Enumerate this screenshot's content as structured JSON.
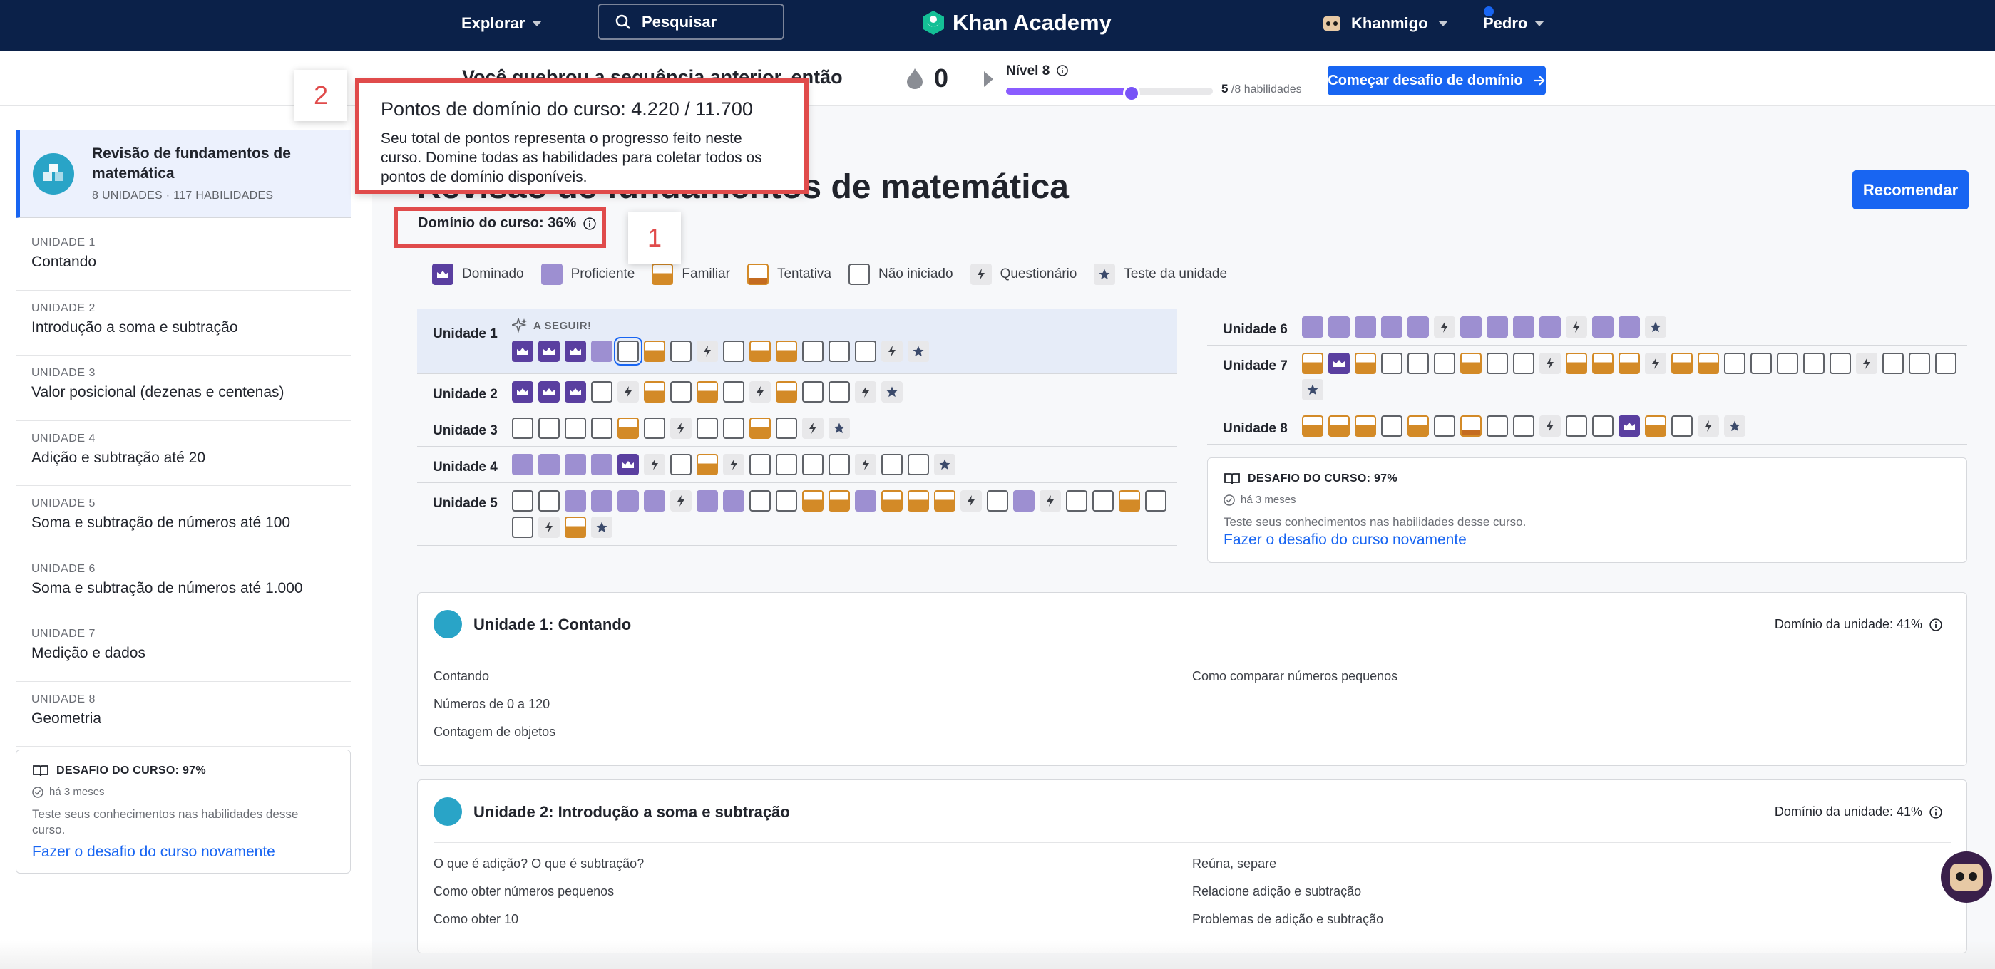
{
  "topbar": {
    "explore": "Explorar",
    "search_placeholder": "Pesquisar",
    "brand": "Khan Academy",
    "khanmigo": "Khanmigo",
    "user": "Pedro"
  },
  "subheader": {
    "streak_message": "Você quebrou a sequência anterior, então",
    "energy_points": "0",
    "level": "Nível 8",
    "level_progress": 0.62,
    "skills_done": "5",
    "skills_total": "/8 habilidades",
    "mastery_button": "Começar desafio de domínio"
  },
  "sidebar": {
    "course_title": "Revisão de fundamentos de matemática",
    "course_meta": "8 UNIDADES · 117 HABILIDADES",
    "units": [
      {
        "label": "UNIDADE 1",
        "name": "Contando"
      },
      {
        "label": "UNIDADE 2",
        "name": "Introdução a soma e subtração"
      },
      {
        "label": "UNIDADE 3",
        "name": "Valor posicional (dezenas e centenas)"
      },
      {
        "label": "UNIDADE 4",
        "name": "Adição e subtração até 20"
      },
      {
        "label": "UNIDADE 5",
        "name": "Soma e subtração de números até 100"
      },
      {
        "label": "UNIDADE 6",
        "name": "Soma e subtração de números até 1.000"
      },
      {
        "label": "UNIDADE 7",
        "name": "Medição e dados"
      },
      {
        "label": "UNIDADE 8",
        "name": "Geometria"
      }
    ],
    "challenge": {
      "title": "DESAFIO DO CURSO: 97%",
      "time": "há 3 meses",
      "desc": "Teste seus conhecimentos nas habilidades desse curso.",
      "link": "Fazer o desafio do curso novamente"
    }
  },
  "main": {
    "course_heading": "Revisão de fundamentos de matemática",
    "recommend": "Recomendar",
    "course_mastery": "Domínio do curso: 36%",
    "legend": {
      "mastered": "Dominado",
      "proficient": "Proficiente",
      "familiar": "Familiar",
      "attempted": "Tentativa",
      "not_started": "Não iniciado",
      "quiz": "Questionário",
      "unit_test": "Teste da unidade"
    },
    "next_up": "A SEGUIR!",
    "unit_rows": [
      {
        "label": "Unidade 1",
        "skills": [
          "M",
          "M",
          "M",
          "P",
          "N*",
          "F",
          "N",
          "Q",
          "N",
          "F",
          "F",
          "N",
          "N",
          "N",
          "Q",
          "T"
        ]
      },
      {
        "label": "Unidade 2",
        "skills": [
          "M",
          "M",
          "M",
          "N",
          "Q",
          "F",
          "N",
          "F",
          "N",
          "Q",
          "F",
          "N",
          "N",
          "Q",
          "T"
        ]
      },
      {
        "label": "Unidade 3",
        "skills": [
          "N",
          "N",
          "N",
          "N",
          "F",
          "N",
          "Q",
          "N",
          "N",
          "F",
          "N",
          "Q",
          "T"
        ]
      },
      {
        "label": "Unidade 4",
        "skills": [
          "P",
          "P",
          "P",
          "P",
          "M",
          "Q",
          "N",
          "F",
          "Q",
          "N",
          "N",
          "N",
          "N",
          "Q",
          "N",
          "N",
          "T"
        ]
      },
      {
        "label": "Unidade 5",
        "skills": [
          "N",
          "N",
          "P",
          "P",
          "P",
          "P",
          "Q",
          "P",
          "P",
          "N",
          "N",
          "F",
          "F",
          "P",
          "F",
          "F",
          "F",
          "Q",
          "N",
          "P",
          "Q",
          "N",
          "N",
          "F",
          "N",
          "N",
          "Q",
          "F",
          "T"
        ]
      },
      {
        "label": "Unidade 6",
        "skills": [
          "P",
          "P",
          "P",
          "P",
          "P",
          "Q",
          "P",
          "P",
          "P",
          "P",
          "Q",
          "P",
          "P",
          "T"
        ]
      },
      {
        "label": "Unidade 7",
        "skills": [
          "F",
          "M",
          "F",
          "N",
          "N",
          "N",
          "F",
          "N",
          "N",
          "Q",
          "F",
          "F",
          "F",
          "Q",
          "F",
          "F",
          "N",
          "N",
          "N",
          "N",
          "N",
          "Q",
          "N",
          "N",
          "N",
          "T"
        ]
      },
      {
        "label": "Unidade 8",
        "skills": [
          "F",
          "F",
          "F",
          "N",
          "F",
          "N",
          "A",
          "N",
          "N",
          "Q",
          "N",
          "N",
          "M",
          "F",
          "N",
          "Q",
          "T"
        ]
      }
    ],
    "right_challenge": {
      "title": "DESAFIO DO CURSO: 97%",
      "time": "há 3 meses",
      "desc": "Teste seus conhecimentos nas habilidades desse curso.",
      "link": "Fazer o desafio do curso novamente"
    },
    "unit_cards": [
      {
        "title": "Unidade 1: Contando",
        "mastery": "Domínio da unidade: 41%",
        "left": [
          "Contando",
          "Números de 0 a 120",
          "Contagem de objetos"
        ],
        "right": [
          "Como comparar números pequenos"
        ]
      },
      {
        "title": "Unidade 2: Introdução a soma e subtração",
        "mastery": "Domínio da unidade: 41%",
        "left": [
          "O que é adição? O que é subtração?",
          "Como obter números pequenos",
          "Como obter 10"
        ],
        "right": [
          "Reúna, separe",
          "Relacione adição e subtração",
          "Problemas de adição e subtração"
        ]
      }
    ]
  },
  "annotations": {
    "tooltip_title": "Pontos de domínio do curso: 4.220 / 11.700",
    "tooltip_desc": "Seu total de pontos representa o progresso feito neste curso. Domine todas as habilidades para coletar todos os pontos de domínio disponíveis.",
    "badge_1": "1",
    "badge_2": "2"
  },
  "colors": {
    "nav": "#0b2149",
    "primary": "#1865f2",
    "mastered": "#5a3fa0",
    "proficient": "#9d8fd1",
    "familiar": "#d38a27",
    "annotation": "#e04b4b"
  }
}
